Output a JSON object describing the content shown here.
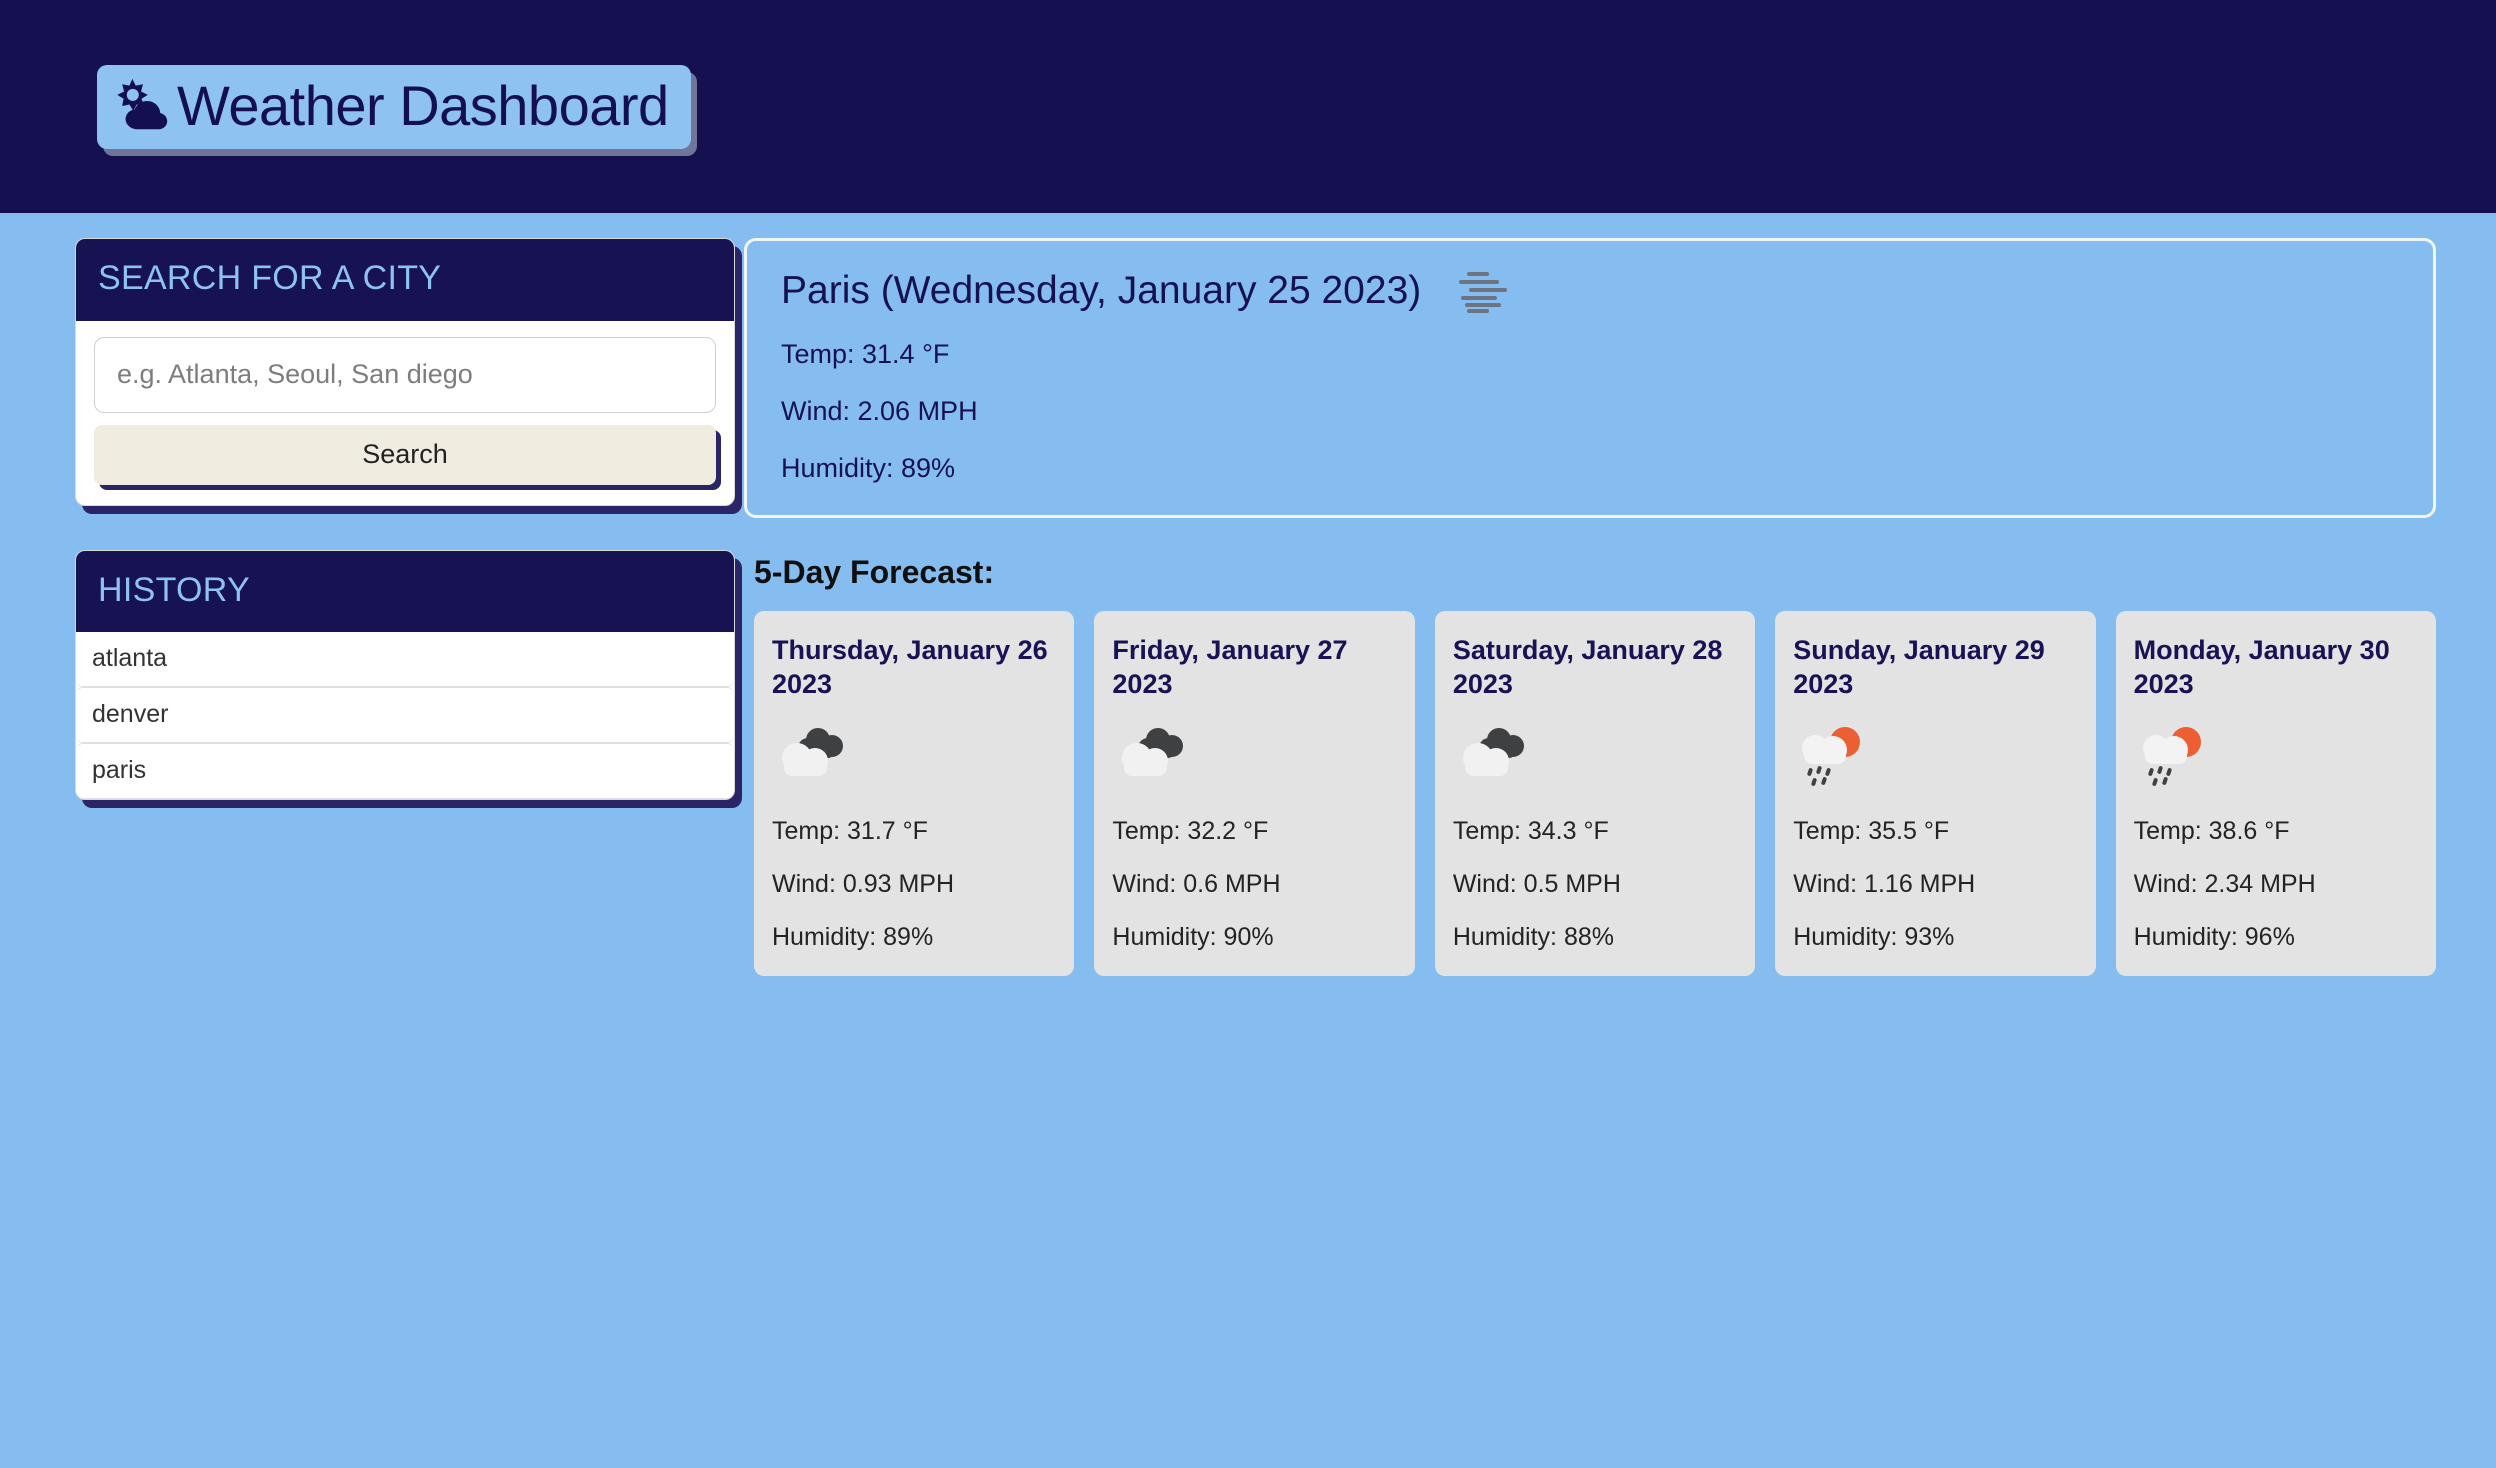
{
  "navbar": {
    "brand_label": "Weather Dashboard",
    "brand_icon": "sun-behind-cloud-icon",
    "background_color": "#151150",
    "badge_color": "#8ec2f0",
    "text_color": "#141050"
  },
  "page": {
    "background_color": "#86bdf0"
  },
  "search_panel": {
    "header_title": "SEARCH FOR A CITY",
    "input_placeholder": "e.g. Atlanta, Seoul, San diego",
    "input_value": "",
    "button_label": "Search",
    "button_color": "#f1ece0"
  },
  "history_panel": {
    "header_title": "HISTORY",
    "items": [
      {
        "label": "atlanta"
      },
      {
        "label": "denver"
      },
      {
        "label": "paris"
      }
    ]
  },
  "current_weather": {
    "title": "Paris (Wednesday, January 25 2023)",
    "icon": "mist-icon",
    "temp": "Temp: 31.4 °F",
    "wind": "Wind: 2.06 MPH",
    "humidity": "Humidity: 89%"
  },
  "forecast": {
    "title": "5-Day Forecast:",
    "cards": [
      {
        "date": "Thursday, January 26 2023",
        "icon": "broken-clouds-icon",
        "temp": "Temp: 31.7 °F",
        "wind": "Wind: 0.93 MPH",
        "humidity": "Humidity: 89%"
      },
      {
        "date": "Friday, January 27 2023",
        "icon": "broken-clouds-icon",
        "temp": "Temp: 32.2 °F",
        "wind": "Wind: 0.6 MPH",
        "humidity": "Humidity: 90%"
      },
      {
        "date": "Saturday, January 28 2023",
        "icon": "broken-clouds-icon",
        "temp": "Temp: 34.3 °F",
        "wind": "Wind: 0.5 MPH",
        "humidity": "Humidity: 88%"
      },
      {
        "date": "Sunday, January 29 2023",
        "icon": "sun-behind-rain-cloud-icon",
        "temp": "Temp: 35.5 °F",
        "wind": "Wind: 1.16 MPH",
        "humidity": "Humidity: 93%"
      },
      {
        "date": "Monday, January 30 2023",
        "icon": "sun-behind-rain-cloud-icon",
        "temp": "Temp: 38.6 °F",
        "wind": "Wind: 2.34 MPH",
        "humidity": "Humidity: 96%"
      }
    ]
  },
  "colors": {
    "navy": "#151150",
    "sky": "#86bdf0",
    "cream": "#f1ece0",
    "card_gray": "#e3e3e3",
    "sun_orange": "#ec5f35",
    "cloud_dark": "#3f4042",
    "cloud_light": "#f1f1f1"
  }
}
